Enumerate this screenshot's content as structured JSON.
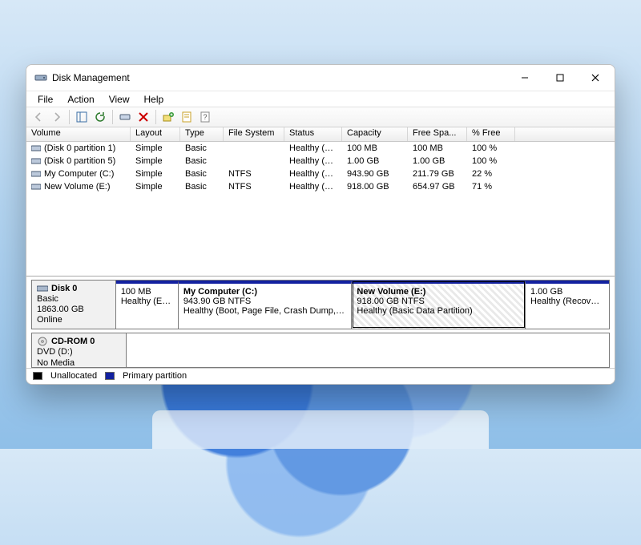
{
  "window": {
    "title": "Disk Management"
  },
  "menu": {
    "file": "File",
    "action": "Action",
    "view": "View",
    "help": "Help"
  },
  "toolbar_icons": {
    "back": "back-arrow-icon",
    "forward": "forward-arrow-icon",
    "up": "up-level-icon",
    "refresh": "refresh-icon",
    "remove": "remove-icon",
    "prop1": "properties-icon",
    "prop2": "properties-alt-icon",
    "help": "help-icon"
  },
  "columns": {
    "c0": "Volume",
    "c1": "Layout",
    "c2": "Type",
    "c3": "File System",
    "c4": "Status",
    "c5": "Capacity",
    "c6": "Free Spa...",
    "c7": "% Free"
  },
  "volumes": [
    {
      "name": "(Disk 0 partition 1)",
      "layout": "Simple",
      "type": "Basic",
      "fs": "",
      "status": "Healthy (E...",
      "capacity": "100 MB",
      "free": "100 MB",
      "pct": "100 %"
    },
    {
      "name": "(Disk 0 partition 5)",
      "layout": "Simple",
      "type": "Basic",
      "fs": "",
      "status": "Healthy (R...",
      "capacity": "1.00 GB",
      "free": "1.00 GB",
      "pct": "100 %"
    },
    {
      "name": "My Computer (C:)",
      "layout": "Simple",
      "type": "Basic",
      "fs": "NTFS",
      "status": "Healthy (B...",
      "capacity": "943.90 GB",
      "free": "211.79 GB",
      "pct": "22 %"
    },
    {
      "name": "New Volume (E:)",
      "layout": "Simple",
      "type": "Basic",
      "fs": "NTFS",
      "status": "Healthy (B...",
      "capacity": "918.00 GB",
      "free": "654.97 GB",
      "pct": "71 %"
    }
  ],
  "disk0": {
    "name": "Disk 0",
    "type": "Basic",
    "size": "1863.00 GB",
    "status": "Online",
    "parts": {
      "p0": {
        "title": "",
        "line1": "100 MB",
        "line2": "Healthy (EFI Sy"
      },
      "p1": {
        "title": "My Computer  (C:)",
        "line1": "943.90 GB NTFS",
        "line2": "Healthy (Boot, Page File, Crash Dump, Basic Data Pa"
      },
      "p2": {
        "title": "New Volume  (E:)",
        "line1": "918.00 GB NTFS",
        "line2": "Healthy (Basic Data Partition)"
      },
      "p3": {
        "title": "",
        "line1": "1.00 GB",
        "line2": "Healthy (Recovery Partiti"
      }
    }
  },
  "cdrom": {
    "name": "CD-ROM 0",
    "type": "DVD (D:)",
    "status": "No Media"
  },
  "legend": {
    "unalloc": "Unallocated",
    "primary": "Primary partition"
  }
}
